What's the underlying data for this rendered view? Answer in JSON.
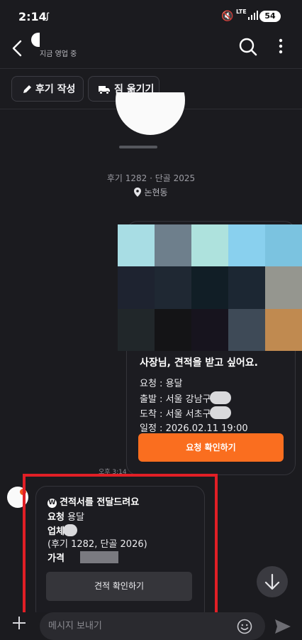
{
  "status_bar": {
    "time": "2:14",
    "tiktok_glyph": "ꭍ",
    "network": "LTE",
    "battery": "54"
  },
  "header": {
    "subtitle": "지금 영업 중"
  },
  "actions": {
    "review_label": "후기 작성",
    "move_label": "짐 옮기기"
  },
  "profile": {
    "stats": "후기 1282 · 단골 2025",
    "location": "논현동"
  },
  "request_card": {
    "title": "사장님, 견적을 받고 싶어요.",
    "lines": [
      {
        "label": "요청",
        "value": "용달"
      },
      {
        "label": "출발",
        "value": "서울 강남구"
      },
      {
        "label": "도착",
        "value": "서울 서초구"
      },
      {
        "label": "일정",
        "value": "2026.02.11 19:00"
      }
    ],
    "button_label": "요청 확인하기",
    "time": "오후 3:14"
  },
  "quote_card": {
    "title": "견적서를 전달드려요",
    "request_label": "요청",
    "request_value": "용달",
    "company_label": "업체",
    "company_detail": "(후기 1282, 단골 2026)",
    "price_label": "가격",
    "button_label": "견적 확인하기"
  },
  "input": {
    "placeholder": "메시지 보내기"
  },
  "colors": {
    "background": "#1b1b1f",
    "accent_orange": "#fa6e1f",
    "annotation_red": "#e11f26"
  }
}
